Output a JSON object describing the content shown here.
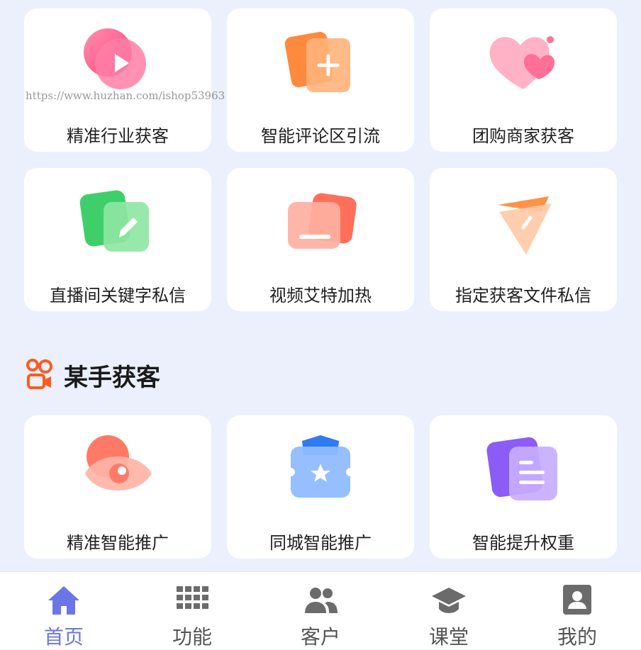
{
  "watermark": "https://www.huzhan.com/ishop53963",
  "grid_top": [
    {
      "label": "精准行业获客",
      "icon": "play-circle-icon"
    },
    {
      "label": "智能评论区引流",
      "icon": "add-document-icon"
    },
    {
      "label": "团购商家获客",
      "icon": "hearts-icon"
    },
    {
      "label": "直播间关键字私信",
      "icon": "edit-pencil-icon"
    },
    {
      "label": "视频艾特加热",
      "icon": "folder-minus-icon"
    },
    {
      "label": "指定获客文件私信",
      "icon": "paper-plane-icon"
    }
  ],
  "section": {
    "title": "某手获客",
    "icon": "kuaishou-logo-icon"
  },
  "grid_bottom": [
    {
      "label": "精准智能推广",
      "icon": "eye-icon"
    },
    {
      "label": "同城智能推广",
      "icon": "star-ticket-icon"
    },
    {
      "label": "智能提升权重",
      "icon": "document-lines-icon"
    }
  ],
  "tabbar": {
    "items": [
      {
        "label": "首页",
        "icon": "home-icon",
        "active": true
      },
      {
        "label": "功能",
        "icon": "grid-icon",
        "active": false
      },
      {
        "label": "客户",
        "icon": "users-icon",
        "active": false
      },
      {
        "label": "课堂",
        "icon": "graduation-cap-icon",
        "active": false
      },
      {
        "label": "我的",
        "icon": "profile-icon",
        "active": false
      }
    ]
  },
  "colors": {
    "background": "#ebf0fc",
    "accent": "#6a76e6",
    "tab_inactive": "#555555"
  }
}
